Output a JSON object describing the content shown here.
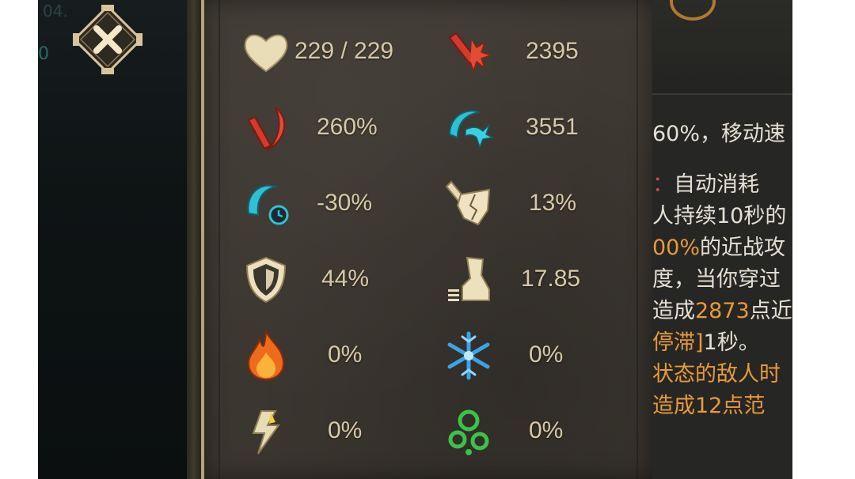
{
  "close_button": {
    "icon": "close-icon"
  },
  "left_text": {
    "top": "04.",
    "mid": "0"
  },
  "stats": [
    {
      "id": "health",
      "icon": "heart-icon",
      "value": "229 / 229"
    },
    {
      "id": "attack-power",
      "icon": "attack-power-icon",
      "value": "2395"
    },
    {
      "id": "melee-damage",
      "icon": "melee-damage-icon",
      "value": "260%"
    },
    {
      "id": "skill-power",
      "icon": "skill-power-icon",
      "value": "3551"
    },
    {
      "id": "cooldown",
      "icon": "cooldown-icon",
      "value": "-30%"
    },
    {
      "id": "crit-chance",
      "icon": "crit-chance-icon",
      "value": "13%"
    },
    {
      "id": "armor",
      "icon": "shield-icon",
      "value": "44%"
    },
    {
      "id": "move-speed",
      "icon": "boot-icon",
      "value": "17.85"
    },
    {
      "id": "fire-resist",
      "icon": "fire-icon",
      "value": "0%"
    },
    {
      "id": "ice-resist",
      "icon": "snowflake-icon",
      "value": "0%"
    },
    {
      "id": "lightning-resist",
      "icon": "lightning-icon",
      "value": "0%"
    },
    {
      "id": "poison-resist",
      "icon": "poison-icon",
      "value": "0%"
    }
  ],
  "description": {
    "l1": "60%，移动速",
    "l2a": "：",
    "l2b": "自动消耗",
    "l3": "人持续10秒的",
    "l4a": "00%",
    "l4b": "的近战攻",
    "l5": "度，当你穿过",
    "l6a": "造成",
    "l6b": "2873",
    "l6c": "点近",
    "l7a": "停滞]",
    "l7b": "1秒。",
    "l8": "状态的敌人时",
    "l9": "造成12点范"
  }
}
